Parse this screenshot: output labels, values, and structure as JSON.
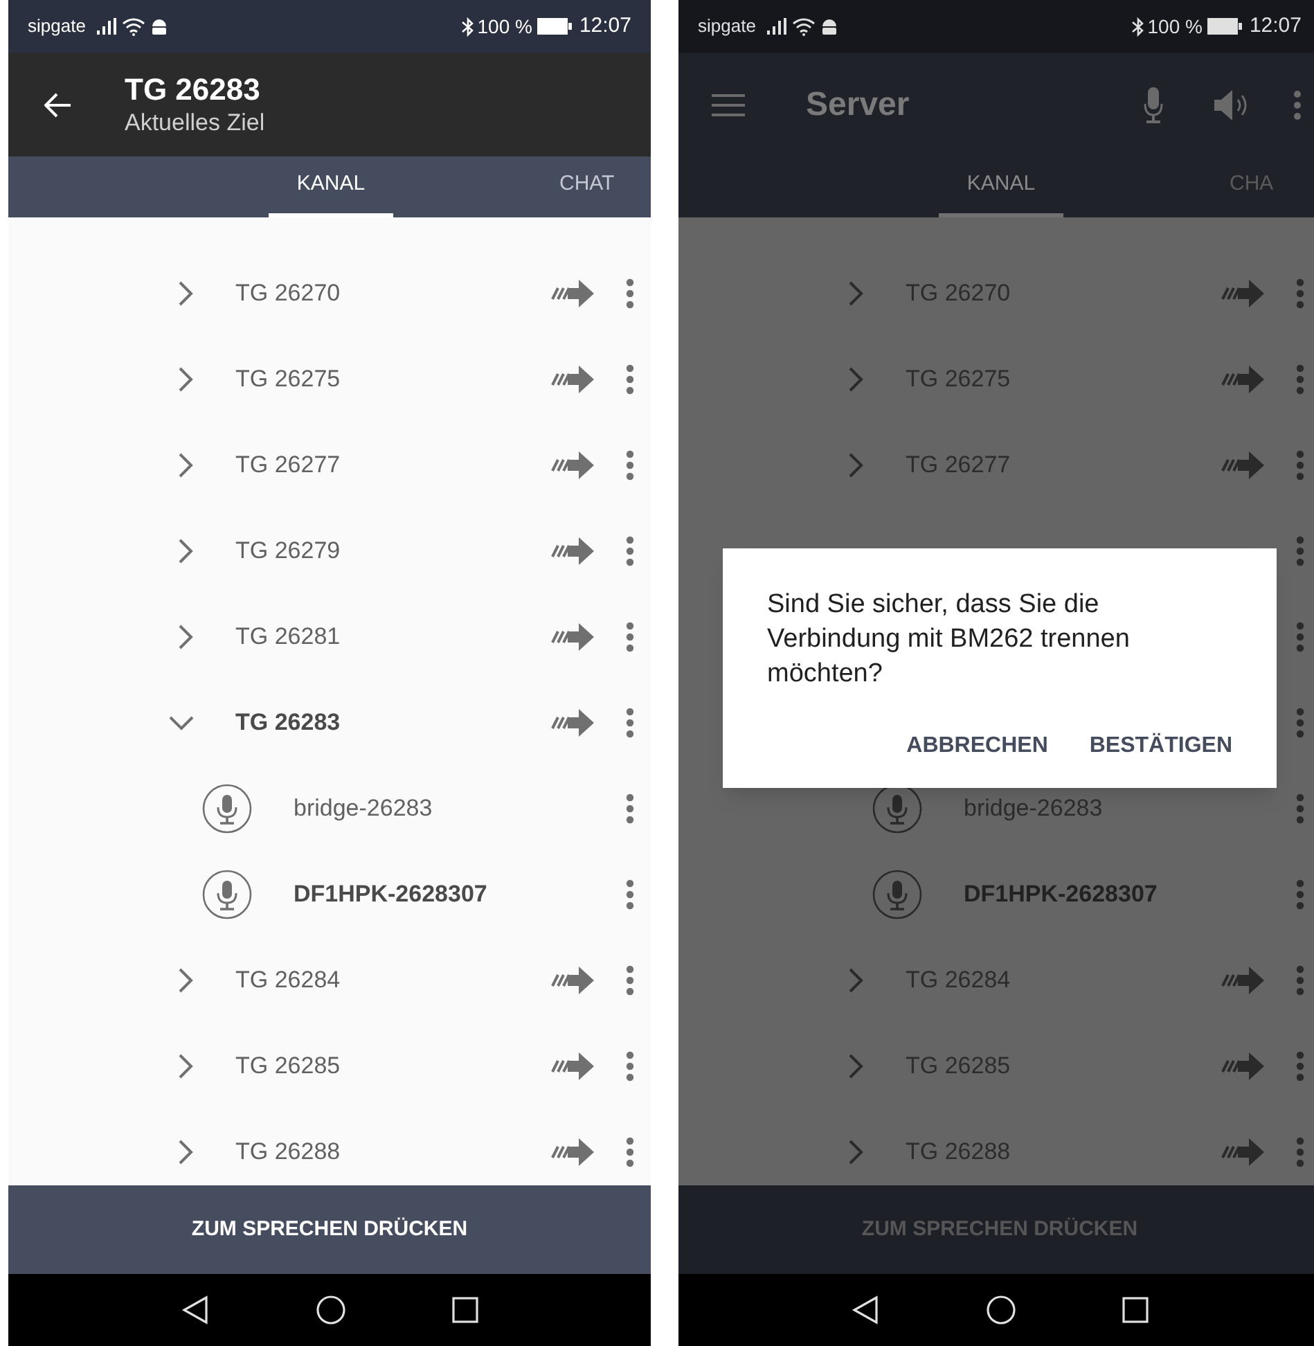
{
  "screens": [
    {
      "status_bar": {
        "carrier": "sipgate",
        "battery": "100 %",
        "time": "12:07"
      },
      "header": {
        "kind": "detail",
        "title": "TG 26283",
        "subtitle": "Aktuelles Ziel"
      },
      "tabs": [
        {
          "label": "KANAL",
          "selected": true
        },
        {
          "label": "CHAT",
          "selected": false
        }
      ],
      "channels": [
        {
          "kind": "group",
          "label": "TG 26270",
          "expanded": false
        },
        {
          "kind": "group",
          "label": "TG 26275",
          "expanded": false
        },
        {
          "kind": "group",
          "label": "TG 26277",
          "expanded": false
        },
        {
          "kind": "group",
          "label": "TG 26279",
          "expanded": false
        },
        {
          "kind": "group",
          "label": "TG 26281",
          "expanded": false
        },
        {
          "kind": "group",
          "label": "TG 26283",
          "expanded": true
        },
        {
          "kind": "member",
          "label": "bridge-26283",
          "active": false
        },
        {
          "kind": "member",
          "label": "DF1HPK-2628307",
          "active": true
        },
        {
          "kind": "group",
          "label": "TG 26284",
          "expanded": false
        },
        {
          "kind": "group",
          "label": "TG 26285",
          "expanded": false
        },
        {
          "kind": "group",
          "label": "TG 26288",
          "expanded": false
        }
      ],
      "talk_button": "ZUM SPRECHEN DRÜCKEN"
    },
    {
      "status_bar": {
        "carrier": "sipgate",
        "battery": "100 %",
        "time": "12:07"
      },
      "header": {
        "kind": "main",
        "title": "Server"
      },
      "tabs": [
        {
          "label": "KANAL",
          "selected": true
        },
        {
          "label": "CHA",
          "selected": false
        }
      ],
      "channels": [
        {
          "kind": "group",
          "label": "TG 26270",
          "expanded": false
        },
        {
          "kind": "group",
          "label": "TG 26275",
          "expanded": false
        },
        {
          "kind": "group",
          "label": "TG 26277",
          "expanded": false
        },
        {
          "kind": "covered"
        },
        {
          "kind": "covered"
        },
        {
          "kind": "covered"
        },
        {
          "kind": "member",
          "label": "bridge-26283",
          "active": false
        },
        {
          "kind": "member",
          "label": "DF1HPK-2628307",
          "active": true
        },
        {
          "kind": "group",
          "label": "TG 26284",
          "expanded": false
        },
        {
          "kind": "group",
          "label": "TG 26285",
          "expanded": false
        },
        {
          "kind": "group",
          "label": "TG 26288",
          "expanded": false
        }
      ],
      "talk_button": "ZUM SPRECHEN DRÜCKEN",
      "dialog": {
        "message": "Sind Sie sicher, dass Sie die Verbindung mit BM262 trennen möchten?",
        "buttons": [
          "ABBRECHEN",
          "BESTÄTIGEN"
        ]
      }
    }
  ]
}
